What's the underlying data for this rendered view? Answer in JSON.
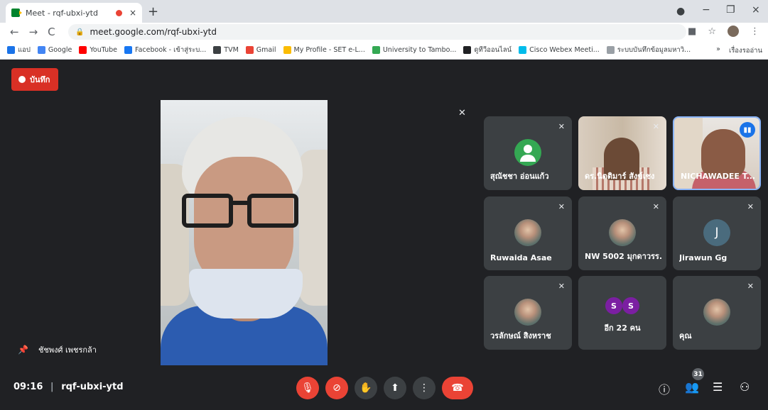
{
  "browser": {
    "tab_title": "Meet - rqf-ubxi-ytd",
    "tab_close": "×",
    "new_tab": "+",
    "url": "meet.google.com/rqf-ubxi-ytd",
    "window_controls": [
      "−",
      "❐",
      "×"
    ]
  },
  "bookmarks": {
    "items": [
      {
        "label": "แอป",
        "icon_color": "#1a73e8"
      },
      {
        "label": "Google",
        "icon_color": "#4285f4"
      },
      {
        "label": "YouTube",
        "icon_color": "#ff0000"
      },
      {
        "label": "Facebook - เข้าสู่ระบ...",
        "icon_color": "#1877f2"
      },
      {
        "label": "TVM",
        "icon_color": "#3c4043"
      },
      {
        "label": "Gmail",
        "icon_color": "#ea4335"
      },
      {
        "label": "My Profile - SET e-L...",
        "icon_color": "#fbbc04"
      },
      {
        "label": "University to Tambo...",
        "icon_color": "#34a853"
      },
      {
        "label": "ดูทีวีออนไลน์",
        "icon_color": "#202124"
      },
      {
        "label": "Cisco Webex Meeti...",
        "icon_color": "#00bceb"
      },
      {
        "label": "ระบบบันทึกข้อมูลมหาวิ...",
        "icon_color": "#9aa0a6"
      }
    ],
    "more": "»",
    "reading_list": "เรื่องรออ่าน"
  },
  "meet": {
    "record_label": "บันทึก",
    "pinned_name": "ชัชพงศ์ เพชรกล้า",
    "meeting_time": "09:16",
    "meeting_code": "rqf-ubxi-ytd",
    "participant_count": "31",
    "tiles": [
      {
        "name": "สุณัชชา อ่อนแก้ว",
        "type": "default"
      },
      {
        "name": "ดร.นิตติมาร์ สังข์เชง",
        "type": "video1"
      },
      {
        "name": "NICHAWADEE T...",
        "type": "video2"
      },
      {
        "name": "Ruwaida Asae",
        "type": "photo"
      },
      {
        "name": "NW 5002 มุกดาวรร...",
        "type": "photo"
      },
      {
        "name": "Jirawun Gg",
        "type": "letter",
        "letter": "J"
      },
      {
        "name": "วรลักษณ์ สิงหราช",
        "type": "photo"
      },
      {
        "name": "อีก 22 คน",
        "type": "more",
        "letters": [
          "S",
          "S"
        ]
      },
      {
        "name": "คุณ",
        "type": "photo"
      }
    ]
  },
  "accent": {
    "record": "#d93025",
    "end_call": "#ea4335",
    "active_border": "#8ab4f8"
  }
}
